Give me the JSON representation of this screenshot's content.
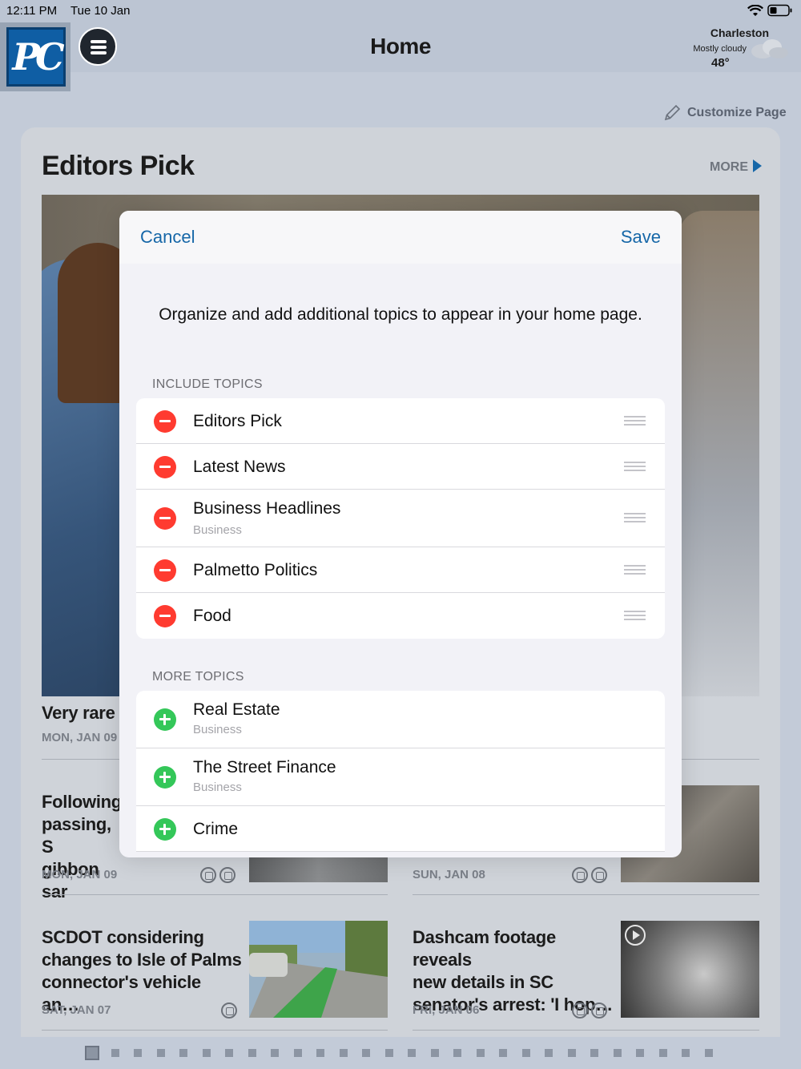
{
  "status": {
    "time": "12:11 PM",
    "date": "Tue 10 Jan"
  },
  "header": {
    "logo_text": "PC",
    "title": "Home",
    "weather": {
      "city": "Charleston",
      "condition": "Mostly cloudy",
      "temp": "48°"
    }
  },
  "customize_label": "Customize Page",
  "section": {
    "title": "Editors Pick",
    "more_label": "MORE"
  },
  "stories": [
    {
      "title": "Very rare i",
      "date": "MON, JAN 09"
    },
    {
      "title_lines": [
        "Following",
        "passing, S",
        "gibbon sar"
      ],
      "date": "MON, JAN 09"
    },
    {
      "date": "SUN, JAN 08"
    },
    {
      "title_lines": [
        "SCDOT considering",
        "changes to Isle of Palms",
        "connector's vehicle an…"
      ],
      "date": "SAT, JAN 07"
    },
    {
      "title_lines": [
        "Dashcam footage reveals",
        "new details in SC",
        "senator's arrest: 'I hop…"
      ],
      "date": "FRI, JAN 06"
    }
  ],
  "modal": {
    "cancel_label": "Cancel",
    "save_label": "Save",
    "description": "Organize and add additional topics to appear in your home page.",
    "include_label": "INCLUDE TOPICS",
    "more_label": "MORE TOPICS",
    "include_topics": [
      {
        "name": "Editors Pick",
        "sub": ""
      },
      {
        "name": "Latest News",
        "sub": ""
      },
      {
        "name": "Business Headlines",
        "sub": "Business"
      },
      {
        "name": "Palmetto Politics",
        "sub": ""
      },
      {
        "name": "Food",
        "sub": ""
      }
    ],
    "more_topics": [
      {
        "name": "Real Estate",
        "sub": "Business"
      },
      {
        "name": "The Street Finance",
        "sub": "Business"
      },
      {
        "name": "Crime",
        "sub": ""
      }
    ]
  },
  "pager": {
    "count": 28,
    "active_index": 0
  },
  "colors": {
    "accent": "#1667a8",
    "remove": "#ff3b30",
    "add": "#34c759"
  }
}
